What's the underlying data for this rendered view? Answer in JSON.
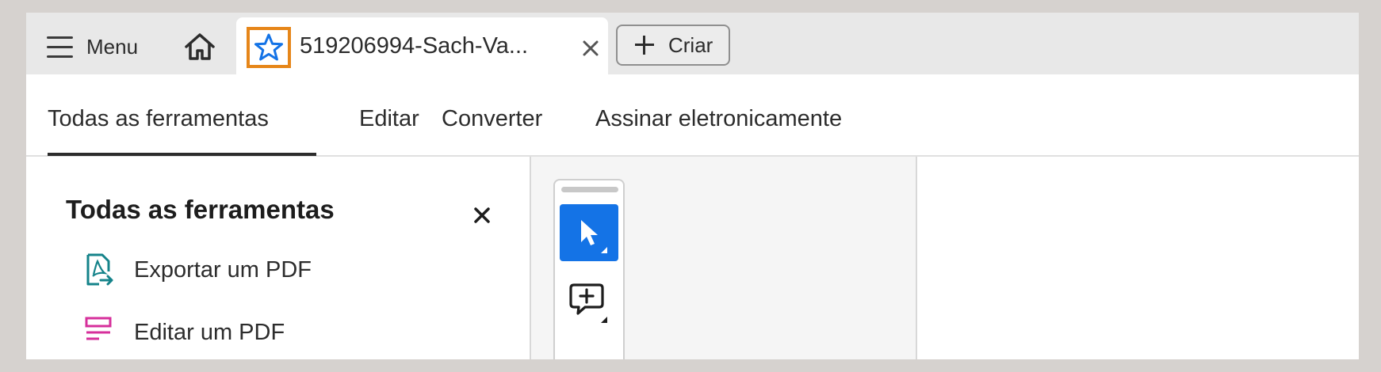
{
  "tabbar": {
    "menu_label": "Menu",
    "home_icon": "home-icon",
    "document_tab": {
      "title": "519206994-Sach-Va...",
      "star_icon": "star-icon",
      "close_icon": "close-icon",
      "star_highlight_color": "#e68619",
      "star_color": "#1473e6"
    },
    "create_label": "Criar"
  },
  "subnav": {
    "items": [
      {
        "label": "Todas as ferramentas",
        "active": true
      },
      {
        "label": "Editar",
        "active": false
      },
      {
        "label": "Converter",
        "active": false
      },
      {
        "label": "Assinar eletronicamente",
        "active": false
      }
    ]
  },
  "tools_panel": {
    "title": "Todas as ferramentas",
    "close_icon": "close-icon",
    "items": [
      {
        "label": "Exportar um PDF",
        "icon": "export-pdf-icon",
        "icon_color": "#15838a"
      },
      {
        "label": "Editar um PDF",
        "icon": "edit-pdf-icon",
        "icon_color": "#d62f9b"
      }
    ]
  },
  "quick_toolbar": {
    "tools": [
      {
        "name": "select-tool",
        "icon": "cursor-icon",
        "active": true
      },
      {
        "name": "comment-tool",
        "icon": "add-comment-icon",
        "active": false
      }
    ],
    "accent_color": "#1473e6"
  }
}
